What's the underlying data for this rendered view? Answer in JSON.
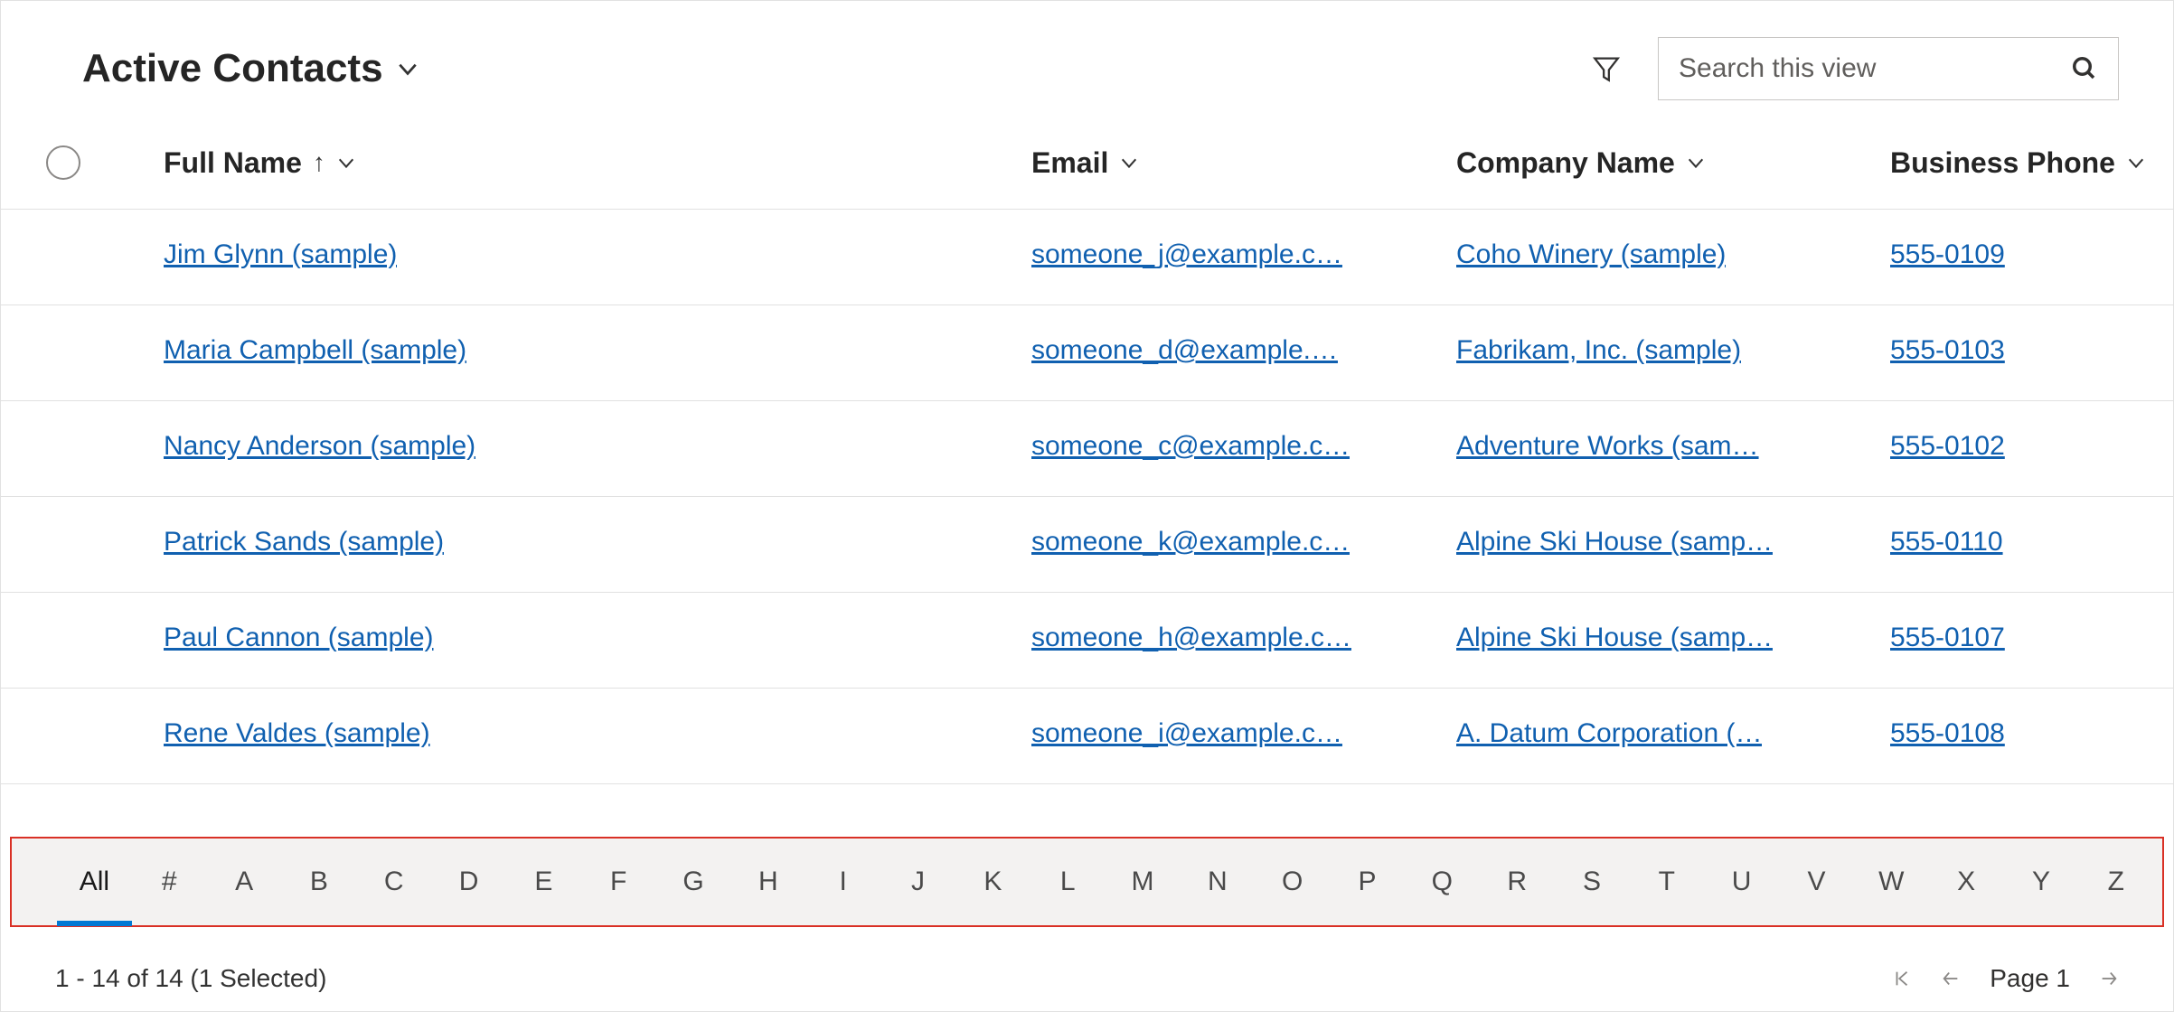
{
  "header": {
    "viewTitle": "Active Contacts",
    "searchPlaceholder": "Search this view"
  },
  "columns": {
    "name": "Full Name",
    "email": "Email",
    "company": "Company Name",
    "phone": "Business Phone"
  },
  "rows": [
    {
      "name": "Jim Glynn (sample)",
      "email": "someone_j@example.c…",
      "company": "Coho Winery (sample)",
      "phone": "555-0109"
    },
    {
      "name": "Maria Campbell (sample)",
      "email": "someone_d@example.…",
      "company": "Fabrikam, Inc. (sample)",
      "phone": "555-0103"
    },
    {
      "name": "Nancy Anderson (sample)",
      "email": "someone_c@example.c…",
      "company": "Adventure Works (sam…",
      "phone": "555-0102"
    },
    {
      "name": "Patrick Sands (sample)",
      "email": "someone_k@example.c…",
      "company": "Alpine Ski House (samp…",
      "phone": "555-0110"
    },
    {
      "name": "Paul Cannon (sample)",
      "email": "someone_h@example.c…",
      "company": "Alpine Ski House (samp…",
      "phone": "555-0107"
    },
    {
      "name": "Rene Valdes (sample)",
      "email": "someone_i@example.c…",
      "company": "A. Datum Corporation (…",
      "phone": "555-0108"
    }
  ],
  "alphaFilter": {
    "active": "All",
    "items": [
      "All",
      "#",
      "A",
      "B",
      "C",
      "D",
      "E",
      "F",
      "G",
      "H",
      "I",
      "J",
      "K",
      "L",
      "M",
      "N",
      "O",
      "P",
      "Q",
      "R",
      "S",
      "T",
      "U",
      "V",
      "W",
      "X",
      "Y",
      "Z"
    ]
  },
  "footer": {
    "status": "1 - 14 of 14 (1 Selected)",
    "pageLabel": "Page 1"
  }
}
